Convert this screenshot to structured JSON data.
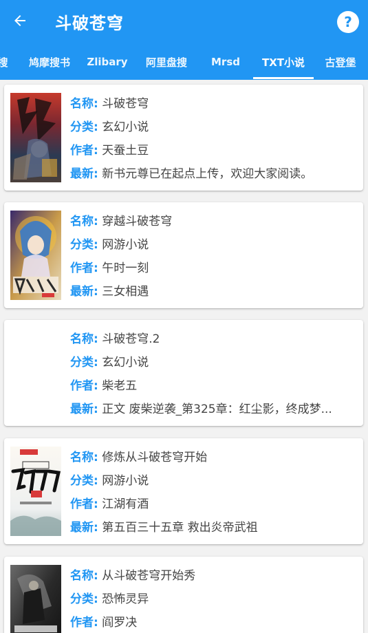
{
  "header": {
    "title": "斗破苍穹",
    "help_symbol": "?"
  },
  "tabs": [
    {
      "label": "搜"
    },
    {
      "label": "鸠摩搜书"
    },
    {
      "label": "Zlibary"
    },
    {
      "label": "阿里盘搜"
    },
    {
      "label": "Mrsd"
    },
    {
      "label": "TXT小说",
      "active": true
    },
    {
      "label": "古登堡"
    }
  ],
  "field_labels": {
    "name": "名称:",
    "category": "分类:",
    "author": "作者:",
    "latest": "最新:"
  },
  "books": [
    {
      "name": "斗破苍穹",
      "category": "玄幻小说",
      "author": "天蚕土豆",
      "latest": "新书元尊已在起点上传，欢迎大家阅读。",
      "cover": "cover-warrior"
    },
    {
      "name": "穿越斗破苍穹",
      "category": "网游小说",
      "author": "午时一刻",
      "latest": "三女相遇",
      "cover": "cover-anime-girl"
    },
    {
      "name": "斗破苍穹.2",
      "category": "玄幻小说",
      "author": "柴老五",
      "latest": "正文 废柴逆袭_第325章：红尘影，终成梦...",
      "cover": "none"
    },
    {
      "name": "修炼从斗破苍穹开始",
      "category": "网游小说",
      "author": "江湖有酒",
      "latest": "第五百三十五章 救出炎帝武祖",
      "cover": "cover-calligraphy"
    },
    {
      "name": "从斗破苍穹开始秀",
      "category": "恐怖灵异",
      "author": "阎罗决",
      "latest": "",
      "cover": "cover-dark"
    }
  ],
  "colors": {
    "primary": "#2196f3",
    "label": "#2196f3",
    "value": "#444444",
    "background": "#f2f2f2"
  }
}
